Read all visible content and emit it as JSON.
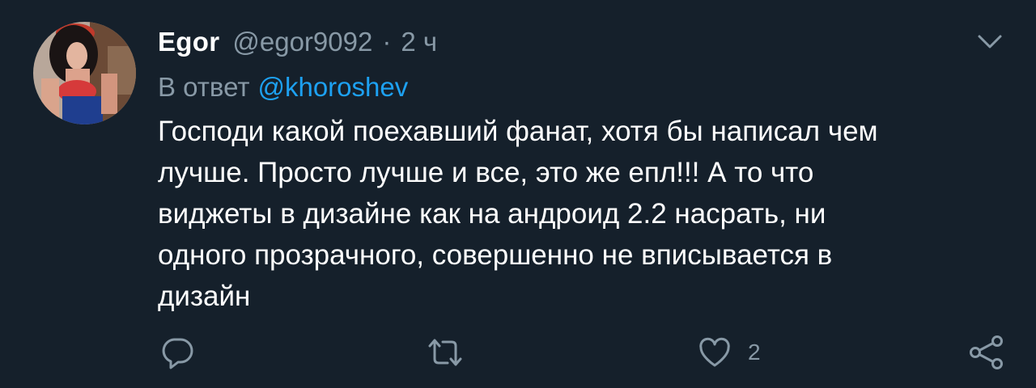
{
  "tweet": {
    "author_name": "Egor",
    "author_handle": "@egor9092",
    "separator": "·",
    "time": "2 ч",
    "reply_prefix": "В ответ",
    "reply_mention": "@khoroshev",
    "text_lines": [
      "Господи какой поехавший фанат, хотя бы написал чем",
      "лучше. Просто лучше и все, это же епл!!! А то что",
      "виджеты в дизайне как на андроид 2.2 насрать, ни",
      "одного прозрачного, совершенно не вписывается в",
      "дизайн"
    ],
    "like_count": "2"
  },
  "icons": {
    "menu": "chevron-down-icon",
    "reply": "reply-icon",
    "retweet": "retweet-icon",
    "like": "heart-icon",
    "share": "share-icon"
  },
  "colors": {
    "background": "#15202b",
    "primary_text": "#ffffff",
    "secondary_text": "#8899a6",
    "link": "#1da1f2"
  }
}
